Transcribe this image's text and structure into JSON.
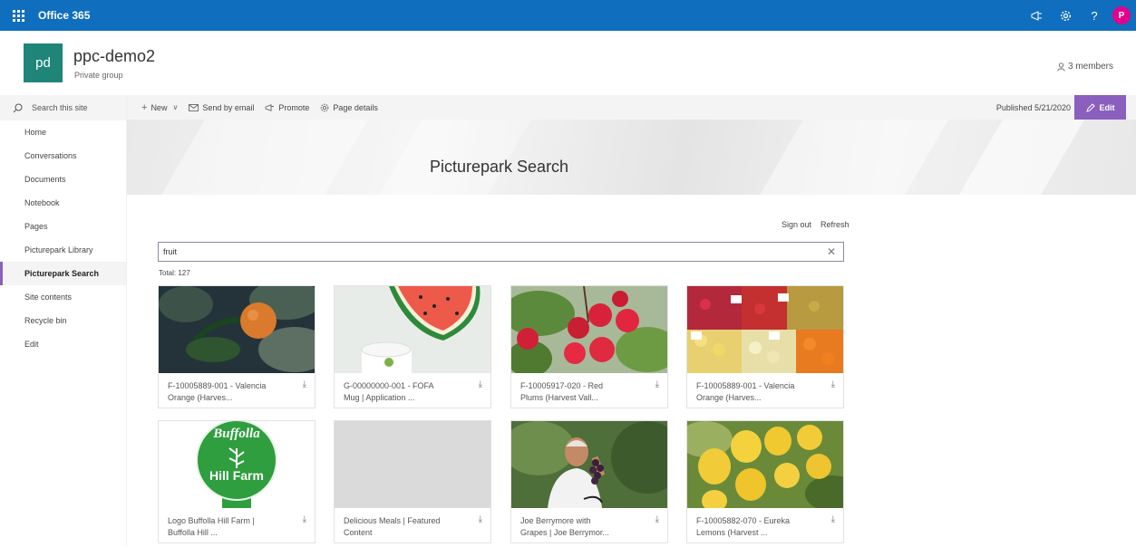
{
  "suite": {
    "app_name": "Office 365",
    "avatar": "P"
  },
  "site": {
    "logo": "pd",
    "title": "ppc-demo2",
    "subtitle": "Private group",
    "members": "3 members"
  },
  "nav": {
    "search": "Search this site",
    "items": [
      "Home",
      "Conversations",
      "Documents",
      "Notebook",
      "Pages",
      "Picturepark Library",
      "Picturepark Search",
      "Site contents",
      "Recycle bin",
      "Edit"
    ],
    "active": "Picturepark Search"
  },
  "cmdbar": {
    "new": "New",
    "send": "Send by email",
    "promote": "Promote",
    "details": "Page details",
    "published": "Published 5/21/2020",
    "edit": "Edit"
  },
  "banner": {
    "title": "Picturepark Search"
  },
  "content": {
    "sign_out": "Sign out",
    "refresh": "Refresh",
    "search_value": "fruit",
    "total": "Total: 127",
    "cards": [
      {
        "l1": "F-10005889-001 - Valencia",
        "l2": "Orange (Harves..."
      },
      {
        "l1": "G-00000000-001 - FOFA",
        "l2": "Mug | Application ..."
      },
      {
        "l1": "F-10005917-020 - Red",
        "l2": "Plums (Harvest Vall..."
      },
      {
        "l1": "F-10005889-001 - Valencia",
        "l2": "Orange (Harves..."
      },
      {
        "l1": "Logo Buffolla Hill Farm |",
        "l2": "Buffolla Hill ..."
      },
      {
        "l1": "Delicious Meals | Featured",
        "l2": "Content"
      },
      {
        "l1": "Joe Berrymore with",
        "l2": "Grapes | Joe Berrymor..."
      },
      {
        "l1": "F-10005882-070 - Eureka",
        "l2": "Lemons (Harvest ..."
      }
    ],
    "logo_text": {
      "top": "Buffolla",
      "bottom": "Hill Farm"
    }
  },
  "colors": {
    "suitebar": "#106ebe",
    "accent": "#8a5fbe",
    "site_logo": "#1e8578",
    "avatar": "#e3008c"
  }
}
